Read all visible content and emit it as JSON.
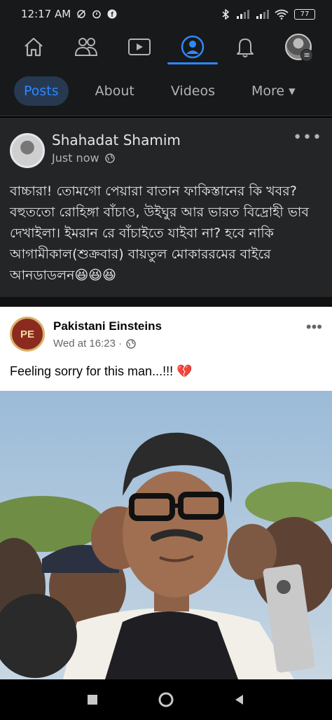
{
  "status": {
    "time": "12:17 AM",
    "battery": "77"
  },
  "nav": {
    "items": [
      "home-icon",
      "friends-icon",
      "watch-icon",
      "profile-icon",
      "notifications-icon",
      "menu-avatar"
    ],
    "active": "profile-icon"
  },
  "tabs": [
    {
      "label": "Posts",
      "active": true
    },
    {
      "label": "About",
      "active": false
    },
    {
      "label": "Videos",
      "active": false
    },
    {
      "label": "More ▾",
      "active": false
    }
  ],
  "post": {
    "author": "Shahadat Shamim",
    "time": "Just now",
    "text": "বাচ্চারা! তোমগো পেয়ারা বাতান ফাকিস্তানের কি খবর? বহুততো রোহিঙ্গা বাঁচাও, উইঘুর আর ভারত বিদ্রোহী ভাব দেখাইলা। ইমরান রে বাঁচাইতে যাইবা না? হবে নাকি আগামীকাল(শুক্রবার) বায়তুল মোকাররমের বাইরে আনডাডলন😆😆😆"
  },
  "shared_post": {
    "logo_text": "PE",
    "author": "Pakistani Einsteins",
    "time": "Wed at 16:23 ·",
    "caption": "Feeling sorry for this man...!!! 💔"
  },
  "colors": {
    "accent": "#2d88ff",
    "dark_bg": "#18191a",
    "card_bg": "#242526"
  }
}
